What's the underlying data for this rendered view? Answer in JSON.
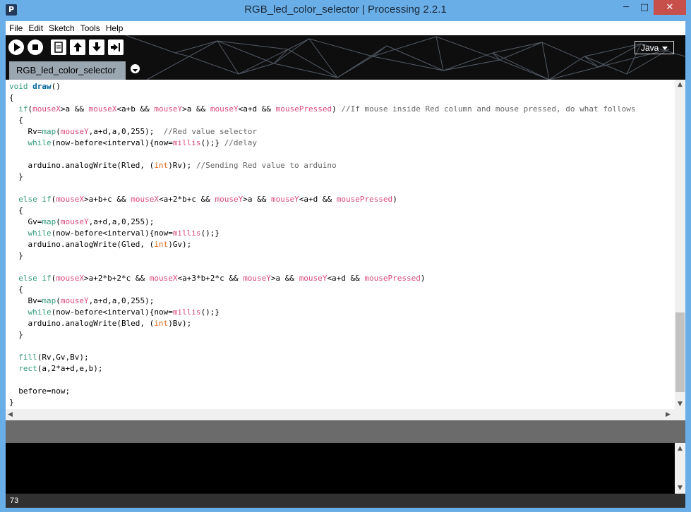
{
  "window": {
    "title": "RGB_led_color_selector | Processing 2.2.1",
    "app_icon": "P",
    "minimize_glyph": "─",
    "maximize_glyph": "□",
    "close_glyph": "✕",
    "titlebar_color": "#6aaee8",
    "close_color": "#c7504a"
  },
  "menu": {
    "items": [
      "File",
      "Edit",
      "Sketch",
      "Tools",
      "Help"
    ]
  },
  "toolbar": {
    "buttons": [
      "run-icon",
      "stop-icon",
      "new-icon",
      "open-icon",
      "save-icon",
      "export-icon"
    ],
    "mode": "Java"
  },
  "tabs": [
    {
      "label": "RGB_led_color_selector",
      "active": true
    }
  ],
  "editor": {
    "lines": [
      [
        [
          "kw",
          "void"
        ],
        [
          "t",
          " "
        ],
        [
          "fn",
          "draw"
        ],
        [
          "t",
          "()"
        ]
      ],
      [
        [
          "t",
          "{"
        ]
      ],
      [
        [
          "t",
          "  "
        ],
        [
          "kw",
          "if"
        ],
        [
          "t",
          "("
        ],
        [
          "bi",
          "mouseX"
        ],
        [
          "t",
          ">a && "
        ],
        [
          "bi",
          "mouseX"
        ],
        [
          "t",
          "<a+b && "
        ],
        [
          "bi",
          "mouseY"
        ],
        [
          "t",
          ">a && "
        ],
        [
          "bi",
          "mouseY"
        ],
        [
          "t",
          "<a+d && "
        ],
        [
          "bi",
          "mousePressed"
        ],
        [
          "t",
          ") "
        ],
        [
          "cm",
          "//If mouse inside Red column and mouse pressed, do what follows"
        ]
      ],
      [
        [
          "t",
          "  {"
        ]
      ],
      [
        [
          "t",
          "    Rv="
        ],
        [
          "kw",
          "map"
        ],
        [
          "t",
          "("
        ],
        [
          "bi",
          "mouseY"
        ],
        [
          "t",
          ",a+d,a,0,255);  "
        ],
        [
          "cm",
          "//Red value selector"
        ]
      ],
      [
        [
          "t",
          "    "
        ],
        [
          "kw",
          "while"
        ],
        [
          "t",
          "(now-before<interval){now="
        ],
        [
          "bi",
          "millis"
        ],
        [
          "t",
          "();} "
        ],
        [
          "cm",
          "//delay"
        ]
      ],
      [
        [
          "t",
          ""
        ]
      ],
      [
        [
          "t",
          "    arduino.analogWrite(Rled, ("
        ],
        [
          "ty",
          "int"
        ],
        [
          "t",
          ")Rv); "
        ],
        [
          "cm",
          "//Sending Red value to arduino"
        ]
      ],
      [
        [
          "t",
          "  }"
        ]
      ],
      [
        [
          "t",
          ""
        ]
      ],
      [
        [
          "t",
          "  "
        ],
        [
          "kw",
          "else"
        ],
        [
          "t",
          " "
        ],
        [
          "kw",
          "if"
        ],
        [
          "t",
          "("
        ],
        [
          "bi",
          "mouseX"
        ],
        [
          "t",
          ">a+b+c && "
        ],
        [
          "bi",
          "mouseX"
        ],
        [
          "t",
          "<a+2*b+c && "
        ],
        [
          "bi",
          "mouseY"
        ],
        [
          "t",
          ">a && "
        ],
        [
          "bi",
          "mouseY"
        ],
        [
          "t",
          "<a+d && "
        ],
        [
          "bi",
          "mousePressed"
        ],
        [
          "t",
          ")"
        ]
      ],
      [
        [
          "t",
          "  {"
        ]
      ],
      [
        [
          "t",
          "    Gv="
        ],
        [
          "kw",
          "map"
        ],
        [
          "t",
          "("
        ],
        [
          "bi",
          "mouseY"
        ],
        [
          "t",
          ",a+d,a,0,255);"
        ]
      ],
      [
        [
          "t",
          "    "
        ],
        [
          "kw",
          "while"
        ],
        [
          "t",
          "(now-before<interval){now="
        ],
        [
          "bi",
          "millis"
        ],
        [
          "t",
          "();}"
        ]
      ],
      [
        [
          "t",
          "    arduino.analogWrite(Gled, ("
        ],
        [
          "ty",
          "int"
        ],
        [
          "t",
          ")Gv);"
        ]
      ],
      [
        [
          "t",
          "  }"
        ]
      ],
      [
        [
          "t",
          ""
        ]
      ],
      [
        [
          "t",
          "  "
        ],
        [
          "kw",
          "else"
        ],
        [
          "t",
          " "
        ],
        [
          "kw",
          "if"
        ],
        [
          "t",
          "("
        ],
        [
          "bi",
          "mouseX"
        ],
        [
          "t",
          ">a+2*b+2*c && "
        ],
        [
          "bi",
          "mouseX"
        ],
        [
          "t",
          "<a+3*b+2*c && "
        ],
        [
          "bi",
          "mouseY"
        ],
        [
          "t",
          ">a && "
        ],
        [
          "bi",
          "mouseY"
        ],
        [
          "t",
          "<a+d && "
        ],
        [
          "bi",
          "mousePressed"
        ],
        [
          "t",
          ")"
        ]
      ],
      [
        [
          "t",
          "  {"
        ]
      ],
      [
        [
          "t",
          "    Bv="
        ],
        [
          "kw",
          "map"
        ],
        [
          "t",
          "("
        ],
        [
          "bi",
          "mouseY"
        ],
        [
          "t",
          ",a+d,a,0,255);"
        ]
      ],
      [
        [
          "t",
          "    "
        ],
        [
          "kw",
          "while"
        ],
        [
          "t",
          "(now-before<interval){now="
        ],
        [
          "bi",
          "millis"
        ],
        [
          "t",
          "();}"
        ]
      ],
      [
        [
          "t",
          "    arduino.analogWrite(Bled, ("
        ],
        [
          "ty",
          "int"
        ],
        [
          "t",
          ")Bv);"
        ]
      ],
      [
        [
          "t",
          "  }"
        ]
      ],
      [
        [
          "t",
          ""
        ]
      ],
      [
        [
          "t",
          "  "
        ],
        [
          "kw",
          "fill"
        ],
        [
          "t",
          "(Rv,Gv,Bv);"
        ]
      ],
      [
        [
          "t",
          "  "
        ],
        [
          "kw",
          "rect"
        ],
        [
          "t",
          "(a,2*a+d,e,b);"
        ]
      ],
      [
        [
          "t",
          ""
        ]
      ],
      [
        [
          "t",
          "  before=now;"
        ]
      ],
      [
        [
          "t",
          "}"
        ]
      ]
    ]
  },
  "status": {
    "line_number": "73"
  }
}
